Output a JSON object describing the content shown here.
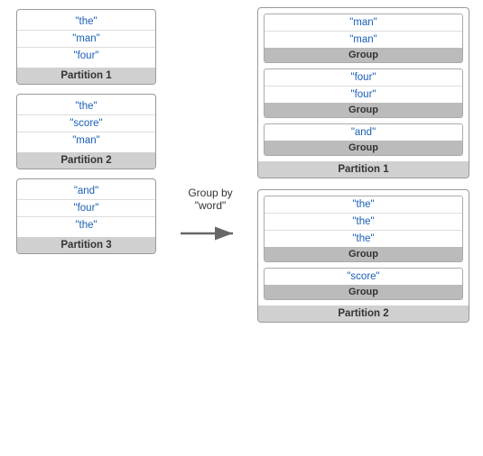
{
  "left": {
    "partitions": [
      {
        "label": "Partition 1",
        "items": [
          "\"the\"",
          "\"man\"",
          "\"four\""
        ]
      },
      {
        "label": "Partition 2",
        "items": [
          "\"the\"",
          "\"score\"",
          "\"man\""
        ]
      },
      {
        "label": "Partition 3",
        "items": [
          "\"and\"",
          "\"four\"",
          "\"the\""
        ]
      }
    ]
  },
  "arrow": {
    "line1": "Group by",
    "line2": "\"word\""
  },
  "right": {
    "partitions": [
      {
        "label": "Partition 1",
        "groups": [
          {
            "items": [
              "\"man\"",
              "\"man\""
            ],
            "label": "Group"
          },
          {
            "items": [
              "\"four\"",
              "\"four\""
            ],
            "label": "Group"
          },
          {
            "items": [
              "\"and\""
            ],
            "label": "Group"
          }
        ]
      },
      {
        "label": "Partition 2",
        "groups": [
          {
            "items": [
              "\"the\"",
              "\"the\"",
              "\"the\""
            ],
            "label": "Group"
          },
          {
            "items": [
              "\"score\""
            ],
            "label": "Group"
          }
        ]
      }
    ]
  }
}
